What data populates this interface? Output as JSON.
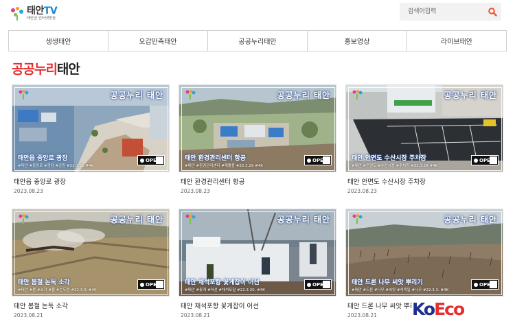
{
  "header": {
    "logo_title": "태안",
    "logo_tv": "TV",
    "logo_sub": "태안군 인터넷방송",
    "search_placeholder": "검색어입력"
  },
  "nav": {
    "items": [
      "생생태안",
      "오감만족태안",
      "공공누리태안",
      "홍보영상",
      "라이브태안"
    ]
  },
  "section": {
    "title_red": "공공누리",
    "title_dark": "태안"
  },
  "overlay": {
    "brand": "공공누리 태안",
    "open_label": "OPEN"
  },
  "cards": [
    {
      "title": "태안읍 중앙로 광장",
      "date": "2023.08.23",
      "caption": "태안읍 중앙로 광장",
      "tags": "#태안 #중앙로 #광장 #공원 #22.3.21 #4K"
    },
    {
      "title": "태안 환경관리센터 항공",
      "date": "2023.08.23",
      "caption": "태안 환경관리센터 항공",
      "tags": "#태안 #환경관리센터 #재활용 #22.3.29 #4K"
    },
    {
      "title": "태안 안면도 수산시장 주차장",
      "date": "2023.08.23",
      "caption": "태안 안면도 수산시장 주차장",
      "tags": "#태안 #안면도 #수산시장 #주차장 #22.3.29 #4K"
    },
    {
      "title": "태안 봄철 논둑 소각",
      "date": "2023.08.21",
      "caption": "태안 봄철 논둑 소각",
      "tags": "#태안 #봄 #소각 #불 #논두렁 #22.3.3. #4K"
    },
    {
      "title": "태안 채석포항 꽃게잡이 어선",
      "date": "2023.08.21",
      "caption": "태안 채석포항 꽃게잡이 어선",
      "tags": "#태안 #꽃게 #어선 #채석포항 #22.3.20. #4K"
    },
    {
      "title": "태안 드론 나무 씨앗 뿌리기",
      "date": "2023.08.21",
      "caption": "태안 드론 나무 씨앗 뿌리기",
      "tags": "#태안 #드론 #나무 #씨앗 #식목일 #나무 #22.3.3. #4K"
    }
  ],
  "watermark": {
    "part1": "Ko",
    "part2": "Eco"
  }
}
